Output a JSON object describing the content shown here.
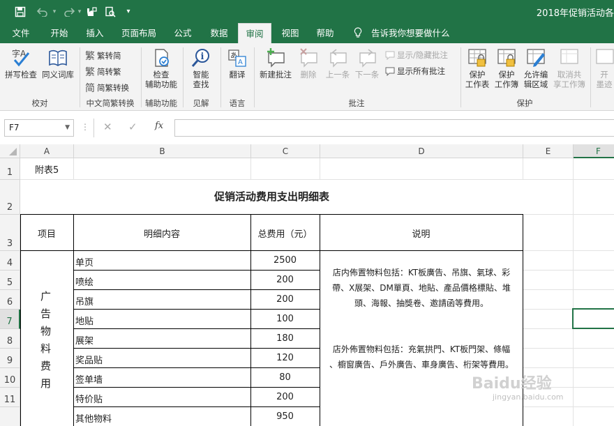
{
  "window": {
    "doc_title": "2018年促销活动各"
  },
  "quick_access": {
    "save": "save-icon",
    "undo": "undo-icon",
    "redo": "redo-icon",
    "customize": "▾"
  },
  "tabs": [
    "文件",
    "开始",
    "插入",
    "页面布局",
    "公式",
    "数据",
    "审阅",
    "视图",
    "帮助"
  ],
  "active_tab": "审阅",
  "tell_me": "告诉我你想要做什么",
  "ribbon": {
    "proofing": {
      "spell": "拼写检查",
      "thesaurus": "同义词库",
      "group": "校对"
    },
    "chinese": {
      "t2s": "繁转简",
      "s2t": "简转繁",
      "convert": "简繁转换",
      "group": "中文简繁转换"
    },
    "accessibility": {
      "check_l1": "检查",
      "check_l2": "辅助功能",
      "group": "辅助功能"
    },
    "insights": {
      "smart_l1": "智能",
      "smart_l2": "查找",
      "group": "见解"
    },
    "language": {
      "translate": "翻译",
      "group": "语言"
    },
    "comments": {
      "new": "新建批注",
      "delete": "删除",
      "prev": "上一条",
      "next": "下一条",
      "show_hide": "显示/隐藏批注",
      "show_all": "显示所有批注",
      "group": "批注"
    },
    "protect": {
      "sheet_l1": "保护",
      "sheet_l2": "工作表",
      "book_l1": "保护",
      "book_l2": "工作簿",
      "range_l1": "允许编",
      "range_l2": "辑区域",
      "unshare_l1": "取消共",
      "unshare_l2": "享工作簿",
      "share_l1": "开",
      "share_l2": "墨迹",
      "group": "保护"
    }
  },
  "formula_bar": {
    "name_box": "F7",
    "fx": "fx",
    "content": ""
  },
  "columns": [
    "A",
    "B",
    "C",
    "D",
    "E",
    "F"
  ],
  "rows": [
    "1",
    "2",
    "3",
    "4",
    "5",
    "6",
    "7",
    "8",
    "9",
    "10",
    "11"
  ],
  "selected_cell": "F7",
  "sheet": {
    "a1": "附表5",
    "title": "促销活动费用支出明细表",
    "header": {
      "item": "项目",
      "detail": "明细内容",
      "cost": "总费用（元）",
      "note": "说明"
    },
    "category": [
      "广",
      "告",
      "物",
      "料",
      "费",
      "用"
    ],
    "items": [
      {
        "name": "单页",
        "cost": "2500"
      },
      {
        "name": "喷绘",
        "cost": "200"
      },
      {
        "name": "吊旗",
        "cost": "200"
      },
      {
        "name": "地贴",
        "cost": "100"
      },
      {
        "name": "展架",
        "cost": "180"
      },
      {
        "name": "奖品贴",
        "cost": "120"
      },
      {
        "name": "签单墙",
        "cost": "80"
      },
      {
        "name": "特价贴",
        "cost": "200"
      },
      {
        "name": "其他物料",
        "cost": "950"
      }
    ],
    "note_indoor": [
      "店内佈置物料包括：KT板廣告、吊旗、氣球、彩",
      "帶、X展架、DM單頁、地貼、產品價格標貼、堆",
      "頭、海報、抽獎卷、邀請函等費用。"
    ],
    "note_outdoor": [
      "店外佈置物料包括：充氣拱門、KT板門架、條幅",
      "、櫥窗廣告、戶外廣告、車身廣告、桁架等費用。"
    ]
  },
  "watermark": {
    "brand": "Baidu经验",
    "url": "jingyan.baidu.com"
  },
  "colors": {
    "excel_green": "#217346",
    "ribbon_bg": "#f3f3f3"
  }
}
